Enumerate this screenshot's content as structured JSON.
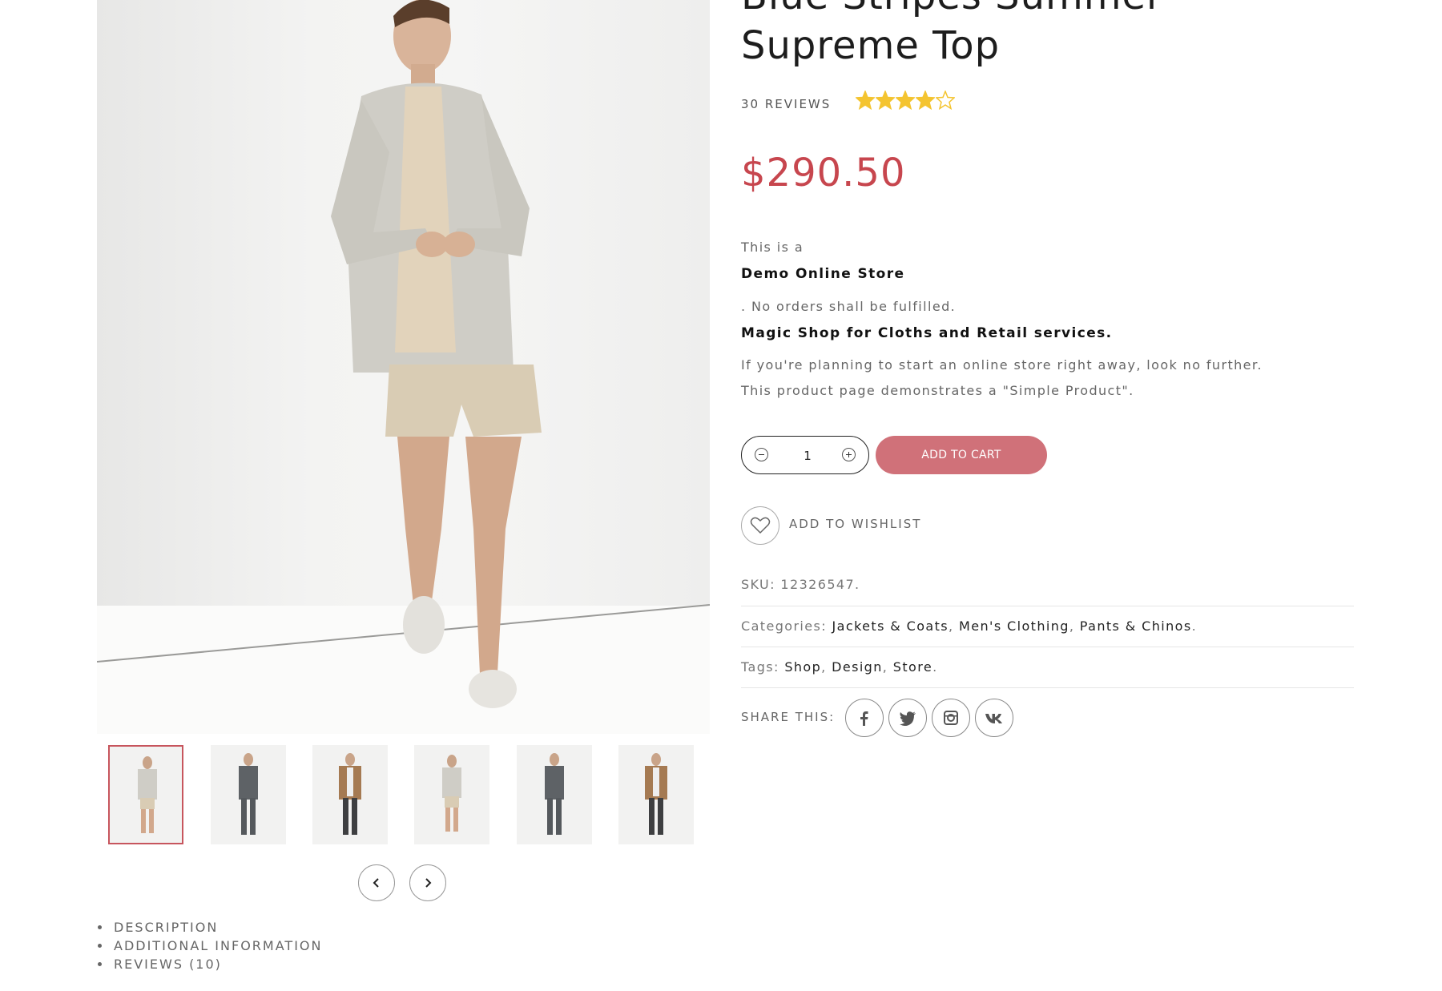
{
  "product": {
    "title_line1": "Blue Stripes Summer",
    "title_line2": "Supreme Top",
    "reviews_label": "30 REVIEWS",
    "rating": 4,
    "rating_max": 5,
    "price": "$290.50"
  },
  "description": {
    "line1": "This is a",
    "line2": "Demo Online Store",
    "line3": ". No orders shall be fulfilled.",
    "line4": "Magic Shop for Cloths and Retail services.",
    "line5": "If you're planning to start an online store right away, look no further.",
    "line6": "This product page demonstrates a \"Simple Product\"."
  },
  "cart": {
    "quantity": "1",
    "add_to_cart_label": "ADD TO CART",
    "wishlist_label": "ADD TO WISHLIST"
  },
  "meta": {
    "sku_label": "SKU:",
    "sku_value": "12326547.",
    "categories_label": "Categories:",
    "categories": [
      "Jackets & Coats",
      "Men's Clothing",
      "Pants & Chinos"
    ],
    "tags_label": "Tags:",
    "tags": [
      "Shop",
      "Design",
      "Store"
    ],
    "share_label": "SHARE THIS:"
  },
  "social_icons": [
    "facebook-icon",
    "twitter-icon",
    "instagram-icon",
    "vk-icon"
  ],
  "tabs": [
    "DESCRIPTION",
    "ADDITIONAL INFORMATION",
    "REVIEWS (10)"
  ],
  "colors": {
    "accent": "#c7464e",
    "button": "#d07179",
    "star": "#f4c430"
  }
}
